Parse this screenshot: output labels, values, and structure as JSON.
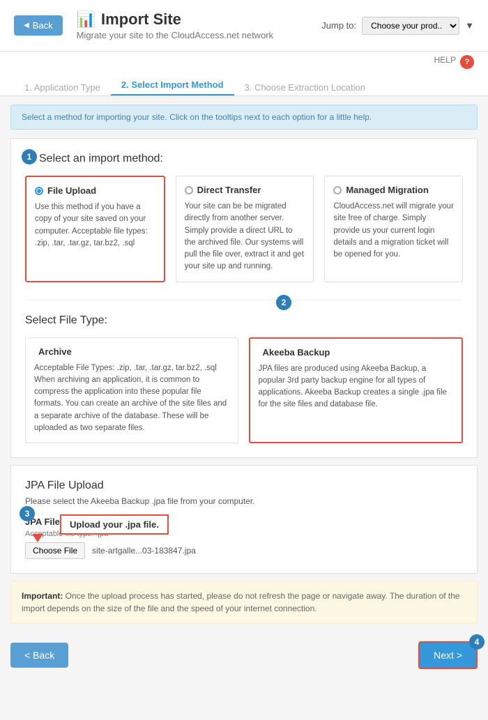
{
  "header": {
    "back_label": "Back",
    "title": "Import Site",
    "subtitle": "Migrate your site to the CloudAccess.net network",
    "jump_to_label": "Jump to:",
    "jump_to_placeholder": "Choose your prod..."
  },
  "help": {
    "label": "HELP"
  },
  "steps": {
    "step1": "1. Application Type",
    "step2": "2. Select Import Method",
    "step3": "3. Choose Extraction Location"
  },
  "info_bar": "Select a method for importing your site. Click on the tooltips next to each option for a little help.",
  "import_method": {
    "title": "Select an import method:",
    "badge": "1",
    "methods": [
      {
        "id": "file_upload",
        "title": "File Upload",
        "selected": true,
        "description": "Use this method if you have a copy of your site saved on your computer. Acceptable file types: .zip, .tar, .tar.gz, tar.bz2, .sql"
      },
      {
        "id": "direct_transfer",
        "title": "Direct Transfer",
        "selected": false,
        "description": "Your site can be be migrated directly from another server. Simply provide a direct URL to the archived file. Our systems will pull the file over, extract it and get your site up and running."
      },
      {
        "id": "managed_migration",
        "title": "Managed Migration",
        "selected": false,
        "description": "CloudAccess.net will migrate your site free of charge. Simply provide us your current login details and a migration ticket will be opened for you."
      }
    ]
  },
  "file_type": {
    "title": "Select File Type:",
    "badge": "2",
    "types": [
      {
        "id": "archive",
        "title": "Archive",
        "selected": false,
        "description": "Acceptable File Types: .zip, .tar, .tar.gz, tar.bz2, .sql When archiving an application, it is common to compress the application into these popular file formats. You can create an archive of the site files and a separate archive of the database. These will be uploaded as two separate files."
      },
      {
        "id": "akeeba",
        "title": "Akeeba Backup",
        "selected": true,
        "description": "JPA files are produced using Akeeba Backup, a popular 3rd party backup engine for all types of applications. Akeeba Backup creates a single .jpa file for the site files and database file."
      }
    ]
  },
  "jpa_upload": {
    "title": "JPA File Upload",
    "subtitle": "Please select the Akeeba Backup .jpa file from your computer.",
    "field_label": "JPA File",
    "field_hint": "Acceptable file type: .jpa",
    "choose_file_label": "Choose File",
    "file_name": "site-artgalle...03-183847.jpa",
    "tooltip_text": "Upload your .jpa file.",
    "badge": "3"
  },
  "important_notice": {
    "prefix": "Important:",
    "text": " Once the upload process has started, please do not refresh the page or navigate away. The duration of the import depends on the size of the file and the speed of your internet connection."
  },
  "footer": {
    "back_label": "< Back",
    "next_label": "Next >",
    "next_badge": "4"
  }
}
